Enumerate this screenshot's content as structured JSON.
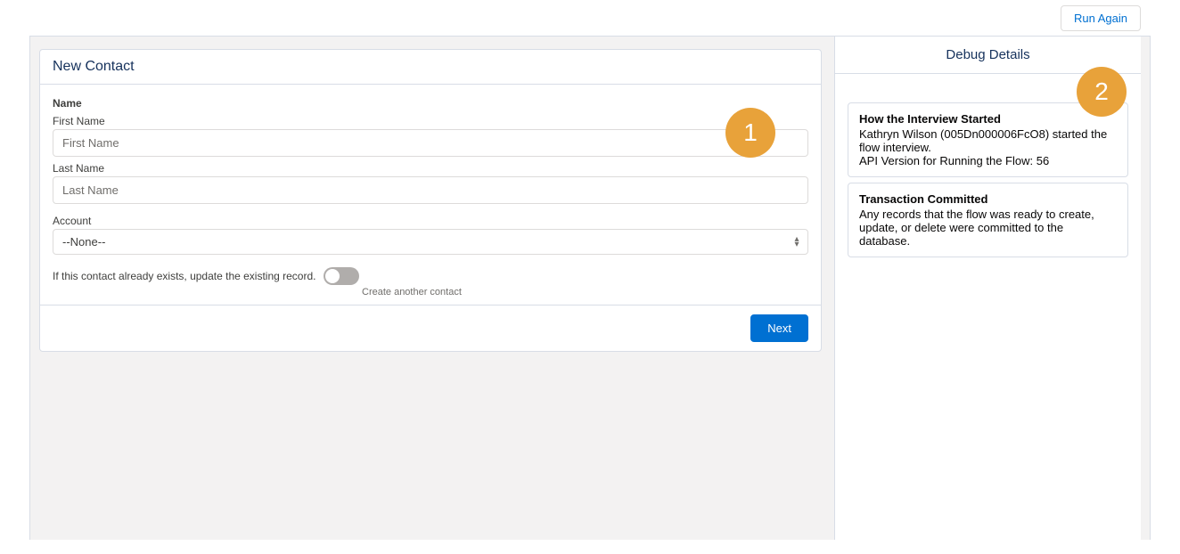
{
  "topbar": {
    "run_again_label": "Run Again"
  },
  "form": {
    "header": "New Contact",
    "name_label": "Name",
    "first_name_label": "First Name",
    "first_name_placeholder": "First Name",
    "last_name_label": "Last Name",
    "last_name_placeholder": "Last Name",
    "account_label": "Account",
    "account_selected": "--None--",
    "toggle_text": "If this contact already exists, update the existing record.",
    "toggle_caption": "Create another contact",
    "next_label": "Next"
  },
  "debug": {
    "header": "Debug Details",
    "cards": [
      {
        "title": "How the Interview Started",
        "line1": "Kathryn Wilson (005Dn000006FcO8) started the flow interview.",
        "line2": "API Version for Running the Flow: 56"
      },
      {
        "title": "Transaction Committed",
        "body": "Any records that the flow was ready to create, update, or delete were committed to the database."
      }
    ]
  },
  "annotations": {
    "one": "1",
    "two": "2"
  }
}
